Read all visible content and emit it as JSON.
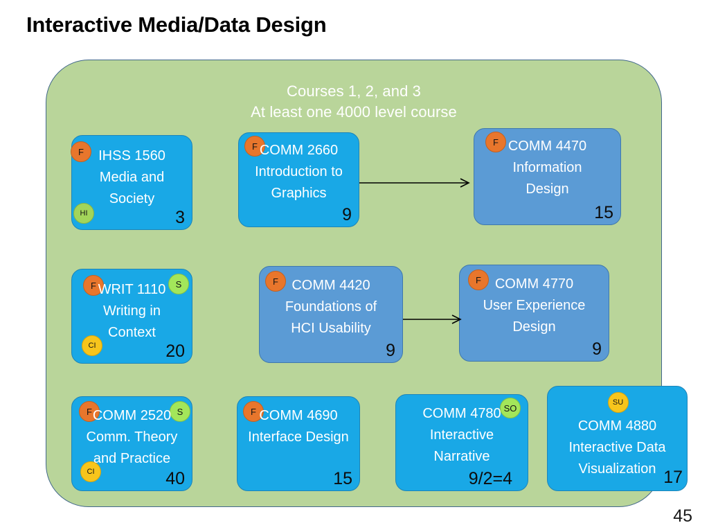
{
  "slide": {
    "title": "Interactive Media/Data Design",
    "page_number": "45",
    "panel_heading_line1": "Courses 1, 2, and 3",
    "panel_heading_line2": "At least one 4000 level course"
  },
  "colors": {
    "panel_green": "#B9D59A",
    "box_cyan": "#19A8E6",
    "box_steel": "#5B9BD5",
    "badge_orange": "#E8762C",
    "badge_green": "#A3E65A",
    "badge_yellow": "#F7C51C",
    "panel_border": "#41678B"
  },
  "courses": [
    {
      "id": "ihss-1560",
      "code": "IHSS 1560",
      "title_line1": "Media and",
      "title_line2": "Society",
      "credits": "3",
      "style": "cyan",
      "badges": [
        {
          "label": "F",
          "kind": "f",
          "pos": "tl"
        },
        {
          "label": "HI",
          "kind": "hi",
          "pos": "bl-edge"
        }
      ]
    },
    {
      "id": "comm-2660",
      "code": "COMM 2660",
      "title_line1": "Introduction to",
      "title_line2": "Graphics",
      "credits": "9",
      "style": "cyan",
      "badges": [
        {
          "label": "F",
          "kind": "f",
          "pos": "tl"
        }
      ]
    },
    {
      "id": "comm-4470",
      "code": "COMM 4470",
      "title_line1": "Information",
      "title_line2": "Design",
      "credits": "15",
      "style": "steel",
      "badges": [
        {
          "label": "F",
          "kind": "f",
          "pos": "tl"
        }
      ]
    },
    {
      "id": "writ-1110",
      "code": "WRIT 1110",
      "title_line1": "Writing in",
      "title_line2": "Context",
      "credits": "20",
      "style": "cyan",
      "badges": [
        {
          "label": "F",
          "kind": "f",
          "pos": "tl"
        },
        {
          "label": "S",
          "kind": "s",
          "pos": "tr"
        },
        {
          "label": "CI",
          "kind": "ci",
          "pos": "bl"
        }
      ]
    },
    {
      "id": "comm-4420",
      "code": "COMM 4420",
      "title_line1": "Foundations of",
      "title_line2": "HCI Usability",
      "credits": "9",
      "style": "steel",
      "badges": [
        {
          "label": "F",
          "kind": "f",
          "pos": "tl"
        }
      ]
    },
    {
      "id": "comm-4770",
      "code": "COMM 4770",
      "title_line1": "User Experience",
      "title_line2": "Design",
      "credits": "9",
      "style": "steel",
      "badges": [
        {
          "label": "F",
          "kind": "f",
          "pos": "tl"
        }
      ]
    },
    {
      "id": "comm-2520",
      "code": "COMM 2520",
      "title_line1": "Comm. Theory",
      "title_line2": "and Practice",
      "credits": "40",
      "style": "cyan",
      "badges": [
        {
          "label": "F",
          "kind": "f",
          "pos": "tl"
        },
        {
          "label": "S",
          "kind": "s",
          "pos": "tr"
        },
        {
          "label": "CI",
          "kind": "ci",
          "pos": "bl"
        }
      ]
    },
    {
      "id": "comm-4690",
      "code": "COMM 4690",
      "title_line1": "Interface Design",
      "title_line2": "",
      "credits": "15",
      "style": "cyan",
      "badges": [
        {
          "label": "F",
          "kind": "f",
          "pos": "tl"
        }
      ]
    },
    {
      "id": "comm-4780",
      "code": "COMM 4780",
      "title_line1": "Interactive",
      "title_line2": "Narrative",
      "credits": "9/2=4",
      "style": "cyan",
      "badges": [
        {
          "label": "SO",
          "kind": "so",
          "pos": "tr"
        }
      ]
    },
    {
      "id": "comm-4880",
      "code": "COMM 4880",
      "title_line1": "Interactive Data",
      "title_line2": "Visualization",
      "credits": "17",
      "style": "cyan",
      "badges": [
        {
          "label": "SU",
          "kind": "su",
          "pos": "tc"
        }
      ]
    }
  ],
  "arrows": [
    {
      "id": "arrow-2660-to-4470",
      "from": "comm-2660",
      "to": "comm-4470"
    },
    {
      "id": "arrow-4420-to-4770",
      "from": "comm-4420",
      "to": "comm-4770"
    }
  ]
}
